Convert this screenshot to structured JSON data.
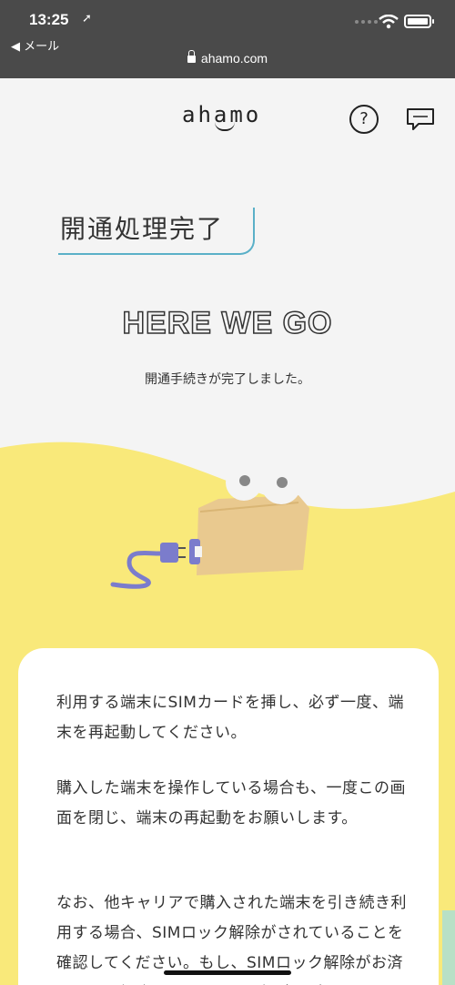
{
  "status_bar": {
    "time": "13:25",
    "location_icon": "location-arrow-icon",
    "back_label": "◀ メール",
    "url": "ahamo.com"
  },
  "header": {
    "logo": "ahamo",
    "help_icon": "question-icon",
    "chat_icon": "chat-bubble-icon"
  },
  "page": {
    "title": "開通処理完了",
    "hero": "HERE WE GO",
    "subtitle": "開通手続きが完了しました。"
  },
  "card": {
    "p1": "利用する端末にSIMカードを挿し、必ず一度、端末を再起動してください。",
    "p2": "購入した端末を操作している場合も、一度この画面を閉じ、端末の再起動をお願いします。",
    "p3": "なお、他キャリアで購入された端末を引き続き利用する場合、SIMロック解除がされていることを確認してください。もし、SIMロック解除がお済みでない場合は、SIMロック解除の手"
  },
  "colors": {
    "accent_line": "#5ab0c8",
    "yellow": "#f9e97a",
    "box": "#e9c98f",
    "plug": "#7b7ccc"
  }
}
